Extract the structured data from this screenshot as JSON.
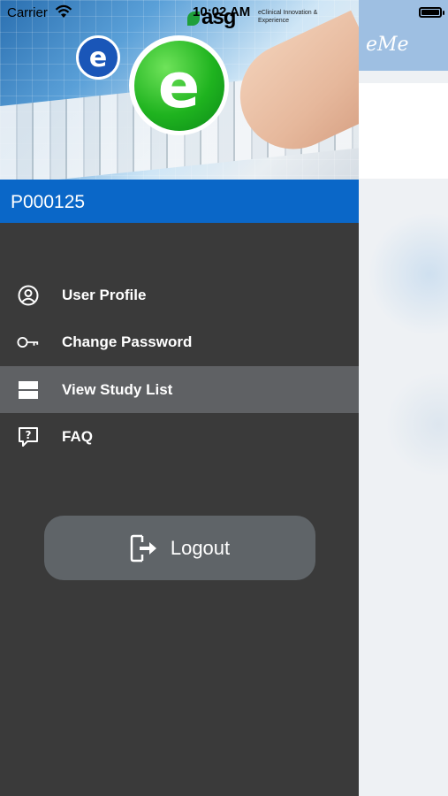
{
  "status_bar": {
    "carrier": "Carrier",
    "time": "10:02 AM"
  },
  "banner": {
    "brand": "asg",
    "tagline": "eClinical Innovation & Experience",
    "small_logo_letter": "e",
    "big_logo_letter": "e"
  },
  "background_app": {
    "logo_text": "eMe"
  },
  "drawer": {
    "participant_id": "P000125",
    "menu": [
      {
        "label": "User Profile",
        "icon": "user-profile-icon",
        "active": false
      },
      {
        "label": "Change Password",
        "icon": "key-icon",
        "active": false
      },
      {
        "label": "View Study List",
        "icon": "study-list-icon",
        "active": true
      },
      {
        "label": "FAQ",
        "icon": "faq-icon",
        "active": false
      }
    ],
    "logout_label": "Logout"
  },
  "colors": {
    "drawer_bg": "#3a3a3a",
    "participant_bar": "#0a67c8",
    "active_item": "#5f6164",
    "logout_button": "#5f6468",
    "nav_bar": "#9ebfe2"
  }
}
